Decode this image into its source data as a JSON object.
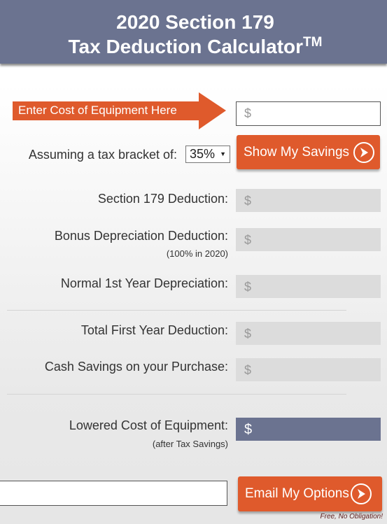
{
  "header": {
    "title_line1": "2020 Section 179",
    "title_line2": "Tax Deduction Calculator",
    "trademark": "TM"
  },
  "cost_input": {
    "arrow_label": "Enter Cost of Equipment Here",
    "placeholder": "$"
  },
  "bracket": {
    "label": "Assuming a tax bracket of:",
    "selected": "35%"
  },
  "show_button": {
    "label": "Show My Savings"
  },
  "results": [
    {
      "label": "Section 179 Deduction:",
      "value": "$"
    },
    {
      "label": "Bonus Depreciation Deduction:",
      "note": "(100% in 2020)",
      "value": "$"
    },
    {
      "label": "Normal 1st Year Depreciation:",
      "value": "$"
    },
    {
      "label": "Total First Year Deduction:",
      "value": "$"
    },
    {
      "label": "Cash Savings on your Purchase:",
      "value": "$"
    }
  ],
  "lowered": {
    "label": "Lowered Cost of Equipment:",
    "note": "(after Tax Savings)",
    "value": "$"
  },
  "email": {
    "value": "",
    "button": "Email My Options",
    "note": "Free, No Obligation!"
  },
  "colors": {
    "header": "#6b7390",
    "accent": "#df5a2c",
    "result_box": "#dcdcdc"
  }
}
